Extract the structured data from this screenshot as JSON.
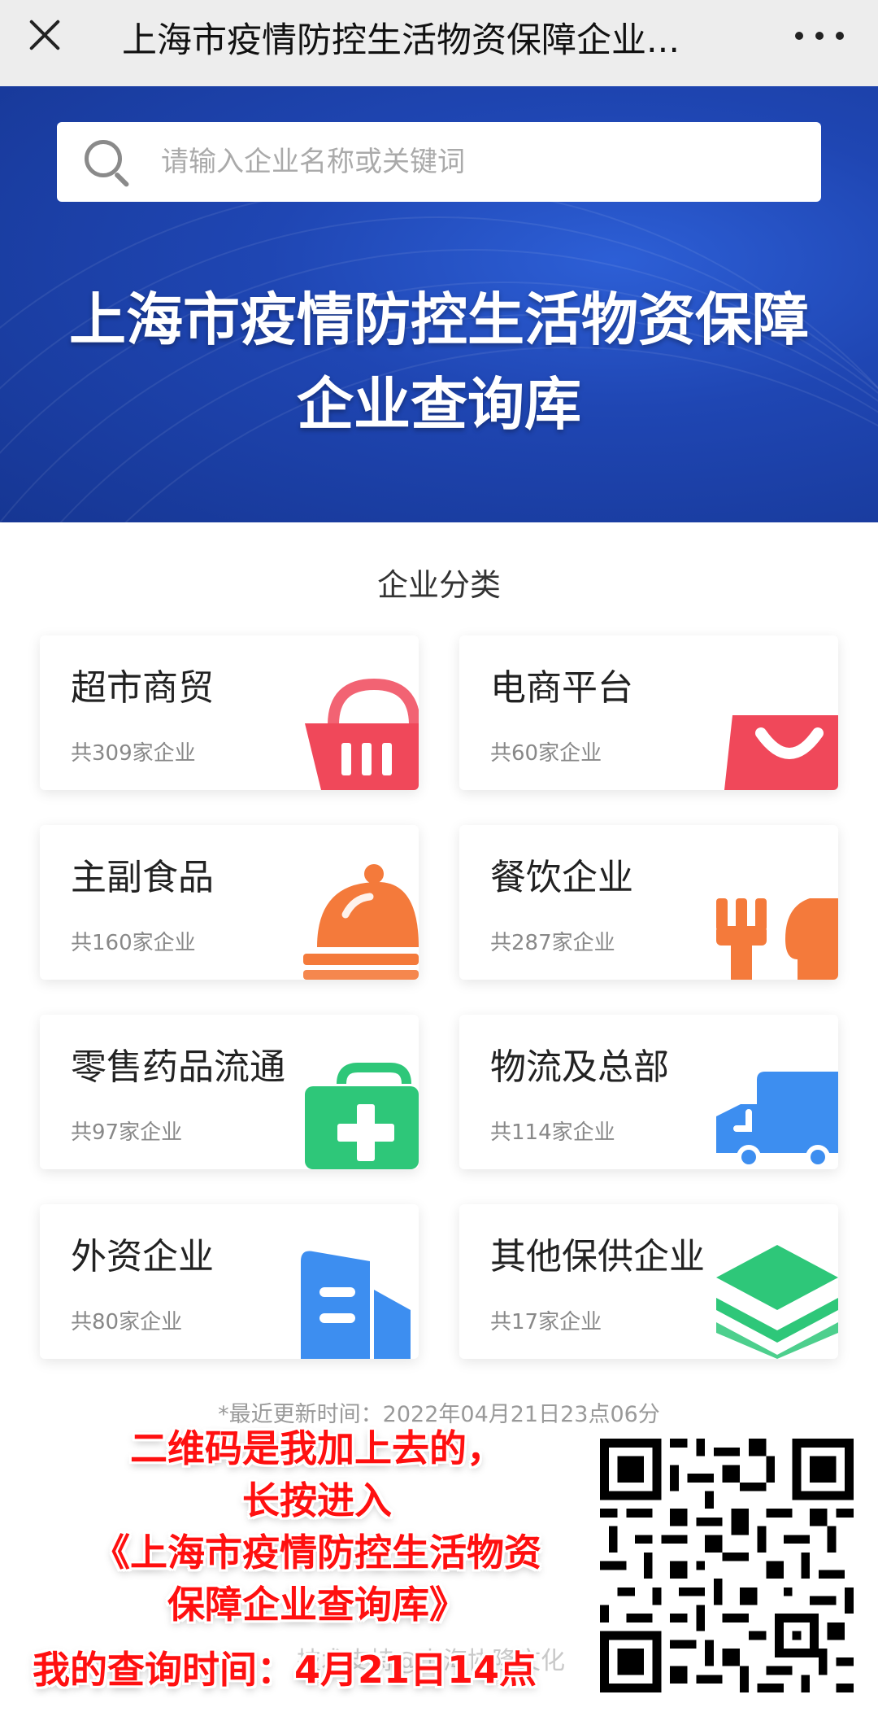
{
  "topbar": {
    "title": "上海市疫情防控生活物资保障企业...",
    "close_icon": "close-icon",
    "more_icon": "more-dots-icon"
  },
  "banner": {
    "search_placeholder": "请输入企业名称或关键词",
    "title_line1": "上海市疫情防控生活物资保障",
    "title_line2": "企业查询库",
    "background_color": "#1f46b3"
  },
  "categories": {
    "section_title": "企业分类",
    "items": [
      {
        "name": "超市商贸",
        "count": "共309家企业",
        "icon": "shopping-basket-icon",
        "color": "#f0485a"
      },
      {
        "name": "电商平台",
        "count": "共60家企业",
        "icon": "shopping-bag-icon",
        "color": "#f0485a"
      },
      {
        "name": "主副食品",
        "count": "共160家企业",
        "icon": "food-cloche-icon",
        "color": "#f47a3b"
      },
      {
        "name": "餐饮企业",
        "count": "共287家企业",
        "icon": "fork-spoon-icon",
        "color": "#f47a3b"
      },
      {
        "name": "零售药品流通",
        "count": "共97家企业",
        "icon": "medical-kit-icon",
        "color": "#2ec779"
      },
      {
        "name": "物流及总部",
        "count": "共114家企业",
        "icon": "delivery-truck-icon",
        "color": "#3d8ef0"
      },
      {
        "name": "外资企业",
        "count": "共80家企业",
        "icon": "building-icon",
        "color": "#3d8ef0"
      },
      {
        "name": "其他保供企业",
        "count": "共17家企业",
        "icon": "layers-icon",
        "color": "#2ec779"
      }
    ]
  },
  "footer": {
    "update_time": "*最近更新时间：2022年04月21日23点06分",
    "support": "技术支持@上海协隆文化"
  },
  "overlay": {
    "line1": "二维码是我加上去的，",
    "line2": "长按进入",
    "line3": "《上海市疫情防控生活物资",
    "line4": "保障企业查询库》",
    "bottom": "我的查询时间：4月21日14点",
    "text_color": "#ff1010"
  },
  "qr_code": {
    "icon": "qr-code-icon"
  }
}
